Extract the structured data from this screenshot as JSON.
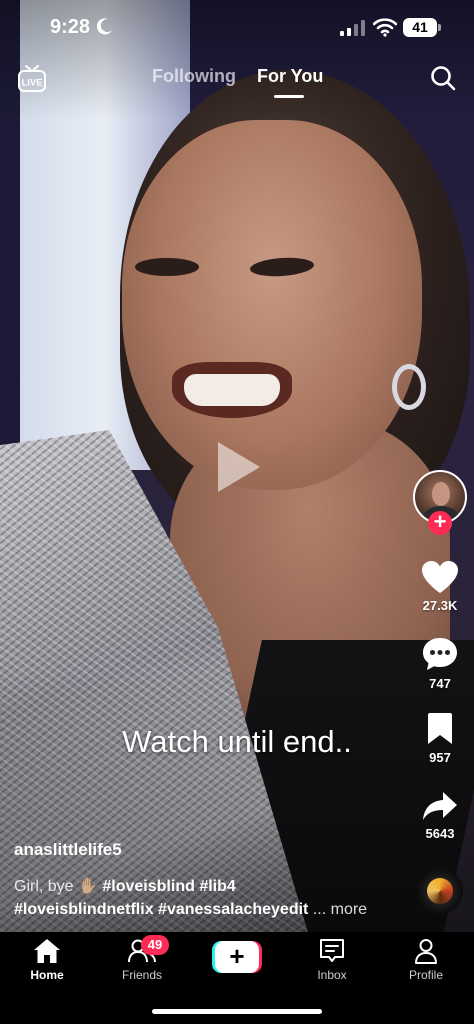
{
  "status_bar": {
    "time": "9:28",
    "battery": "41",
    "icons": [
      "moon-icon",
      "signal-icon",
      "wifi-icon"
    ]
  },
  "top_nav": {
    "live_icon": "live-icon",
    "live_label": "LIVE",
    "tabs": [
      {
        "label": "Following",
        "active": false
      },
      {
        "label": "For You",
        "active": true
      }
    ],
    "search_icon": "search-icon"
  },
  "video": {
    "overlay_text": "Watch until end..",
    "play_icon": "play-icon"
  },
  "actions": {
    "follow_icon": "plus-icon",
    "likes": "27.3K",
    "comments": "747",
    "bookmarks": "957",
    "shares": "5643"
  },
  "post": {
    "username": "anaslittlelife5",
    "caption_text": "Girl, bye ✋🏼",
    "caption_tags_line1": [
      "#loveisblind",
      "#lib4"
    ],
    "caption_tags_line2": [
      "#loveisblindnetflix",
      "#vanessalacheyedit"
    ],
    "more_label": "... more"
  },
  "tabbar": {
    "home": "Home",
    "friends": "Friends",
    "friends_badge": "49",
    "create": "+",
    "inbox": "Inbox",
    "profile": "Profile"
  },
  "colors": {
    "accent_red": "#fe2c55",
    "accent_cyan": "#25f4ee",
    "background": "#000000"
  }
}
